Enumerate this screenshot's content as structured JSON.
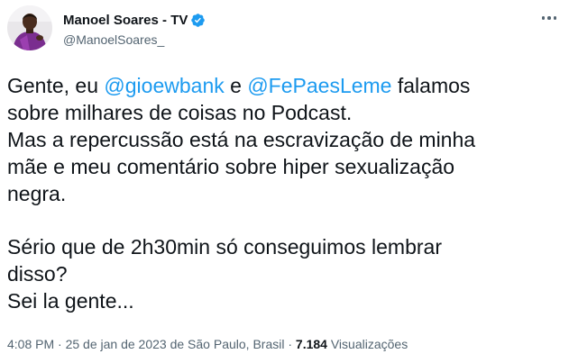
{
  "author": {
    "display_name": "Manoel Soares - TV",
    "handle": "@ManoelSoares_",
    "verified": true,
    "verified_icon": "verified-badge-icon",
    "verified_color": "#1d9bf0"
  },
  "menu_icon": "more-options-icon",
  "tweet": {
    "line1_pre": "Gente, eu ",
    "mention1": "@gioewbank",
    "line1_mid": " e ",
    "mention2": "@FePaesLeme",
    "line1_post": " falamos",
    "line2": "sobre milhares de coisas no Podcast.",
    "line3": "Mas a repercussão está na escravização de minha",
    "line4": "mãe e meu comentário sobre hiper sexualização",
    "line5": "negra.",
    "line6": "Sério que de 2h30min só conseguimos lembrar",
    "line7": "disso?",
    "line8": "Sei la gente..."
  },
  "meta": {
    "time": "4:08 PM",
    "sep1": " · ",
    "date": "25 de jan de 2023",
    "location": " de São Paulo, Brasil",
    "sep2": " · ",
    "views_count": "7.184",
    "views_label": " Visualizações"
  },
  "colors": {
    "link": "#1d9bf0",
    "text": "#0f1419",
    "secondary": "#536471"
  }
}
